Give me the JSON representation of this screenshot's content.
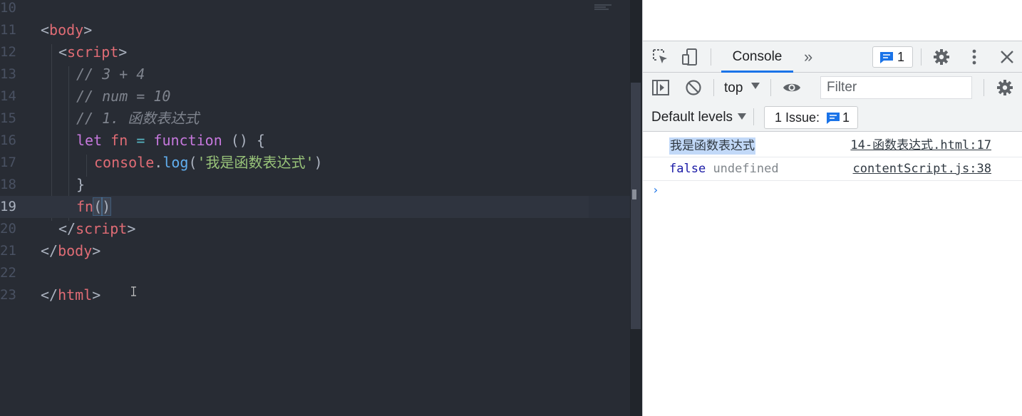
{
  "editor": {
    "lines": [
      {
        "num": "10"
      },
      {
        "num": "11"
      },
      {
        "num": "12"
      },
      {
        "num": "13"
      },
      {
        "num": "14"
      },
      {
        "num": "15"
      },
      {
        "num": "16"
      },
      {
        "num": "17"
      },
      {
        "num": "18"
      },
      {
        "num": "19"
      },
      {
        "num": "20"
      },
      {
        "num": "21"
      },
      {
        "num": "22"
      },
      {
        "num": "23"
      }
    ],
    "active_line": "19",
    "tokens": {
      "body_open": "body",
      "script_open": "script",
      "comment1": "// 3 + 4",
      "comment2": "// num = 10",
      "comment3": "// 1. 函数表达式",
      "let_kw": "let",
      "fn_var": "fn",
      "equals": "=",
      "function_kw": "function",
      "paren_brace": " () {",
      "console_obj": "console",
      "log_method": "log",
      "log_string": "'我是函数表达式'",
      "close_brace": "}",
      "call_fn": "fn",
      "call_open": "(",
      "call_close": ")",
      "script_close": "script",
      "body_close": "body",
      "html_close": "html"
    }
  },
  "devtools": {
    "tabs": {
      "console_label": "Console",
      "more_label": "»",
      "issues_count": "1"
    },
    "toolbar": {
      "context": "top",
      "filter_placeholder": "Filter",
      "levels": "Default levels",
      "issue_chip_label": "1 Issue:",
      "issue_chip_count": "1"
    },
    "messages": [
      {
        "text": "我是函数表达式",
        "source": "14-函数表达式.html:17"
      },
      {
        "text_false": "false",
        "text_undefined": "undefined",
        "source": "contentScript.js:38"
      }
    ],
    "prompt": "›"
  },
  "colors": {
    "editor_bg": "#282c34",
    "tag": "#e06c75",
    "keyword": "#c678dd",
    "function": "#61afef",
    "string": "#98c379",
    "comment": "#7f848e",
    "accent": "#1a73e8"
  }
}
